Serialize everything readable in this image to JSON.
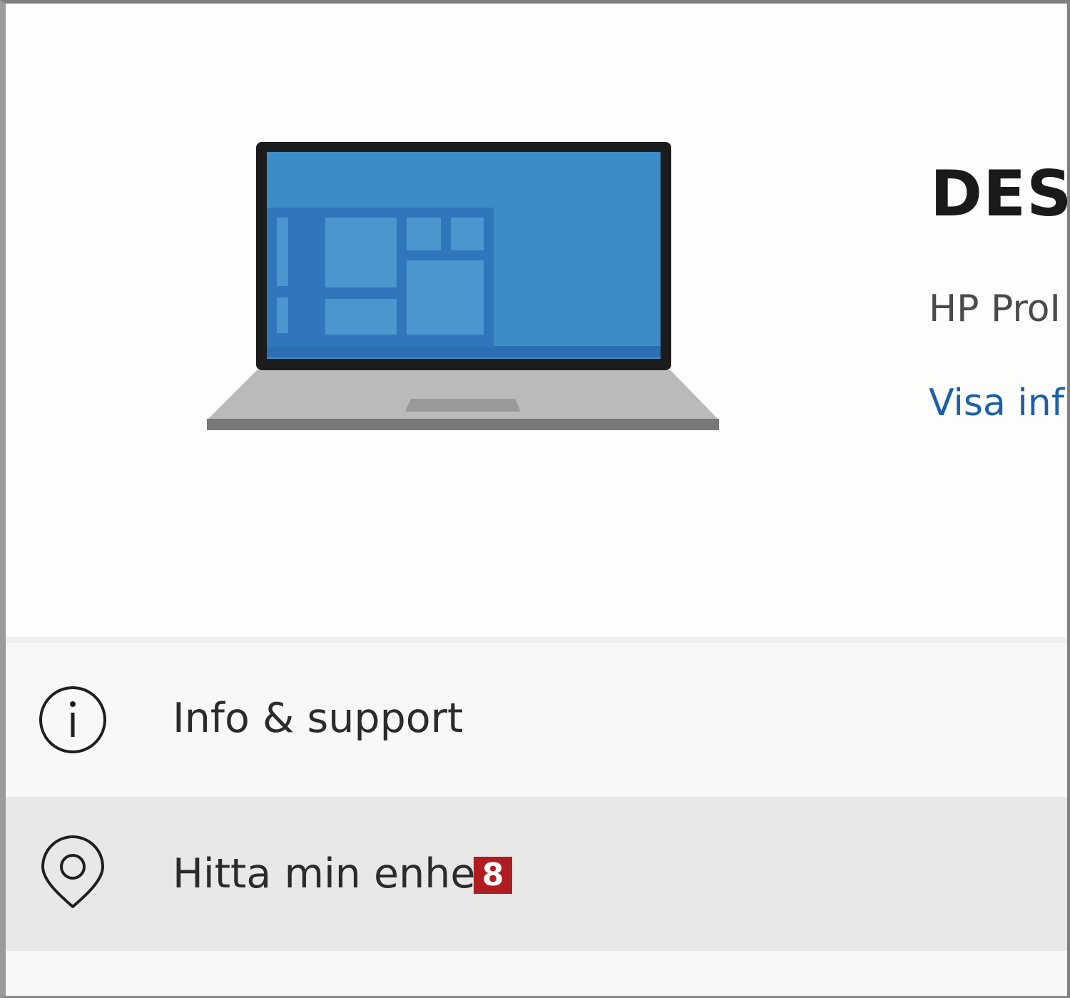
{
  "device": {
    "name": "DESI",
    "model": "HP ProI",
    "link_label": "Visa inf"
  },
  "list": {
    "items": [
      {
        "label": "Info & support",
        "icon": "info-icon"
      },
      {
        "label": "Hitta min enhet",
        "icon": "location-pin-icon",
        "badge": "8"
      }
    ]
  },
  "colors": {
    "accent_link": "#1d5fa8",
    "screen_blue": "#3c8dc5",
    "badge_red": "#b01c22",
    "selected_row": "#e8e8e6"
  }
}
